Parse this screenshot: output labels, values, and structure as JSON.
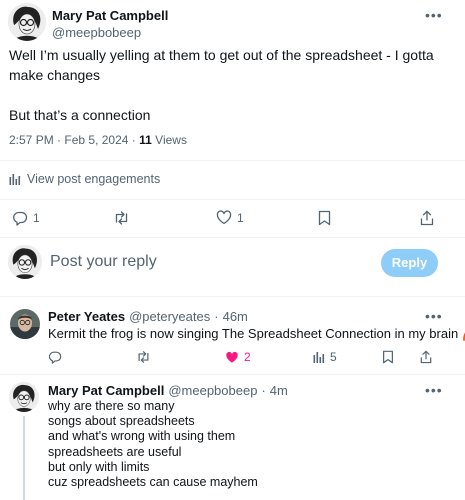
{
  "main_post": {
    "author_name": "Mary Pat Campbell",
    "author_handle": "@meepbobeep",
    "more_icon": "more-icon",
    "body_line1": "Well I’m usually yelling at them to get out of the spreadsheet - I gotta",
    "body_line2": "make changes",
    "body_line3": "But that’s a connection",
    "time": "2:57 PM",
    "date": "Feb 5, 2024",
    "views_count": "11",
    "views_label": "Views",
    "engagements_label": "View post engagements",
    "actions": {
      "replies": "1",
      "likes": "1"
    }
  },
  "composer": {
    "placeholder": "Post your reply",
    "reply_button": "Reply"
  },
  "replies": [
    {
      "author_name": "Peter Yeates",
      "author_handle": "@peteryeates",
      "age": "46m",
      "text": "Kermit the frog is now singing The Spreadsheet Connection in my brain",
      "emoji": "🌈",
      "likes": "2",
      "views": "5",
      "like_color": "#f91880"
    },
    {
      "author_name": "Mary Pat Campbell",
      "author_handle": "@meepbobeep",
      "age": "4m",
      "lines": [
        "why are there so many",
        "songs about spreadsheets",
        "and what's wrong with using them",
        "spreadsheets are useful",
        "but only with limits",
        "cuz spreadsheets can cause mayhem"
      ]
    }
  ],
  "colors": {
    "accent": "#1d9bf0",
    "reply_button_disabled": "#8ecdf8",
    "muted": "#536471"
  }
}
